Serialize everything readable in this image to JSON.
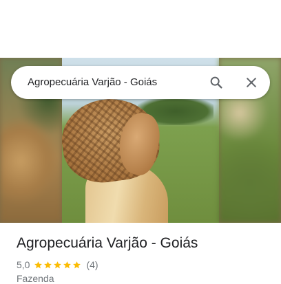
{
  "search": {
    "query": "Agropecuária Varjão - Goiás",
    "search_icon": "search-icon",
    "close_icon": "close-icon"
  },
  "place": {
    "title": "Agropecuária Varjão - Goiás",
    "rating": "5,0",
    "stars_filled": 5,
    "stars_total": 5,
    "review_count": "(4)",
    "category": "Fazenda"
  },
  "colors": {
    "star": "#fbbc04",
    "icon": "#5f6368",
    "title": "#202124",
    "secondary": "#70757a"
  }
}
